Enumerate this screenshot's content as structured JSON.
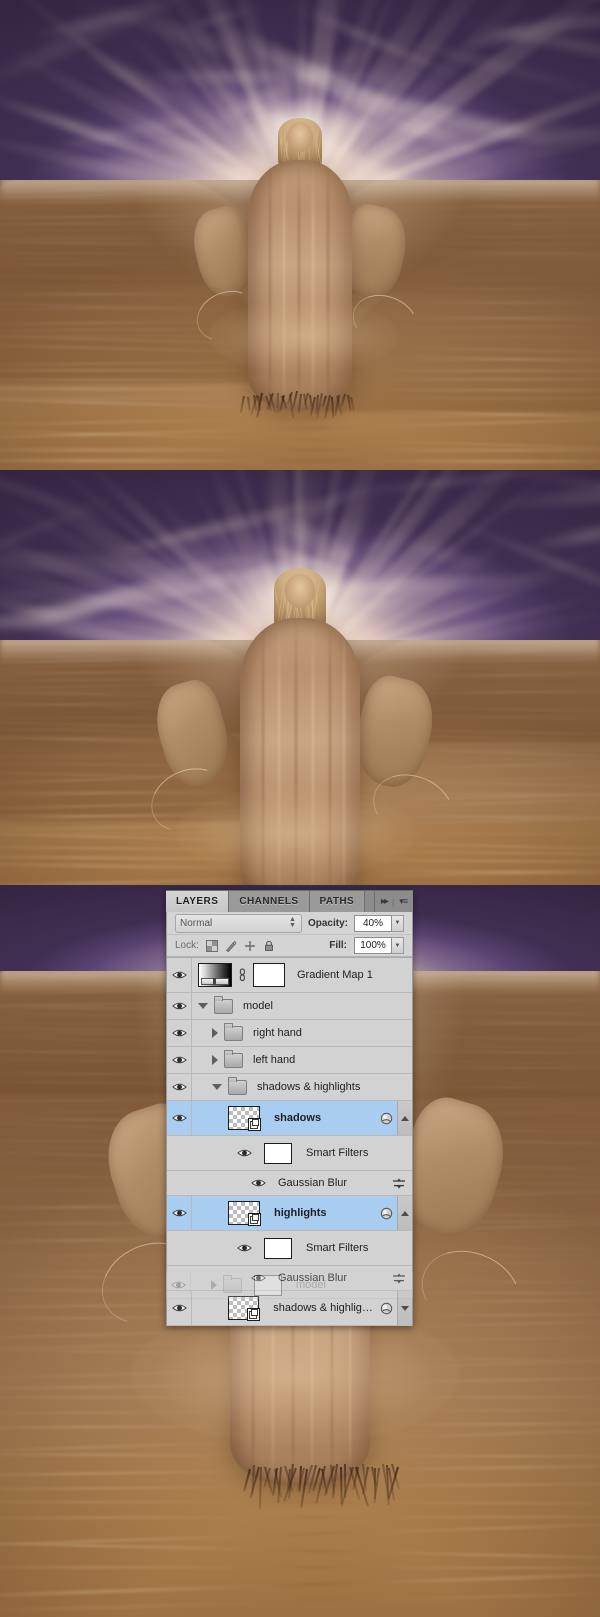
{
  "document": {
    "title": "Desert model photo manipulation — Photoshop layers panel",
    "panel_count": 3
  },
  "images": [
    {
      "name": "step-1-image",
      "caption": "Desert dunes under radiant sky with model figure, wide view"
    },
    {
      "name": "step-2-image",
      "caption": "Desert dunes under radiant sky with model figure, closer crop"
    },
    {
      "name": "step-3-image",
      "caption": "Desert dunes with model figure and Photoshop layers panel overlay"
    }
  ],
  "layers_panel": {
    "tabs": [
      {
        "label": "LAYERS",
        "active": true
      },
      {
        "label": "CHANNELS",
        "active": false
      },
      {
        "label": "PATHS",
        "active": false
      }
    ],
    "header_buttons": {
      "collapse": "▸▸",
      "separator": "|",
      "menu": "▾≡"
    },
    "blend": {
      "mode": "Normal",
      "opacity_label": "Opacity:",
      "opacity_value": "40%",
      "fill_label": "Fill:",
      "fill_value": "100%"
    },
    "lock": {
      "label": "Lock:",
      "icons": [
        "lock-transparent-pixels-icon",
        "lock-image-pixels-icon",
        "lock-position-icon",
        "lock-all-icon"
      ]
    },
    "rows": [
      {
        "name": "Gradient Map 1",
        "kind": "adjustment",
        "indent": 0,
        "visible": true,
        "selected": false,
        "bold": false,
        "thumb": "gradient-map-thumbnail",
        "mask": "layer-mask-white",
        "link": true,
        "disclosure": "none",
        "fx": false,
        "scroll": "none"
      },
      {
        "name": "model",
        "kind": "group",
        "indent": 0,
        "visible": true,
        "selected": false,
        "bold": false,
        "thumb": "folder-icon",
        "disclosure": "down",
        "fx": false,
        "scroll": "none"
      },
      {
        "name": "right hand",
        "kind": "group",
        "indent": 1,
        "visible": true,
        "selected": false,
        "bold": false,
        "thumb": "folder-icon",
        "disclosure": "right",
        "fx": false,
        "scroll": "none"
      },
      {
        "name": "left hand",
        "kind": "group",
        "indent": 1,
        "visible": true,
        "selected": false,
        "bold": false,
        "thumb": "folder-icon",
        "disclosure": "right",
        "fx": false,
        "scroll": "none"
      },
      {
        "name": "shadows & highlights",
        "kind": "group",
        "indent": 1,
        "visible": true,
        "selected": false,
        "bold": false,
        "thumb": "folder-icon",
        "disclosure": "down",
        "fx": false,
        "scroll": "none"
      },
      {
        "name": "shadows",
        "kind": "smart-object",
        "indent": 2,
        "visible": true,
        "selected": true,
        "bold": true,
        "thumb": "transparent-checker-thumbnail",
        "disclosure": "none",
        "fx": true,
        "scroll": "up"
      },
      {
        "name": "Smart Filters",
        "kind": "smart-filters",
        "indent": 3,
        "visible": true,
        "selected": false,
        "bold": false,
        "thumb": "filter-mask-white",
        "disclosure": "none",
        "fx": false,
        "scroll": "none"
      },
      {
        "name": "Gaussian Blur",
        "kind": "filter",
        "indent": 4,
        "visible": true,
        "selected": false,
        "bold": false,
        "thumb": "none",
        "disclosure": "none",
        "fx": false,
        "blend_options": "filter-blending-options-icon",
        "scroll": "none"
      },
      {
        "name": "highlights",
        "kind": "smart-object",
        "indent": 2,
        "visible": true,
        "selected": true,
        "bold": true,
        "thumb": "transparent-checker-thumbnail",
        "disclosure": "none",
        "fx": true,
        "scroll": "up"
      },
      {
        "name": "Smart Filters",
        "kind": "smart-filters",
        "indent": 3,
        "visible": true,
        "selected": false,
        "bold": false,
        "thumb": "filter-mask-white",
        "disclosure": "none",
        "fx": false,
        "scroll": "none"
      },
      {
        "name": "Gaussian Blur",
        "kind": "filter",
        "indent": 4,
        "visible": true,
        "selected": false,
        "bold": false,
        "thumb": "none",
        "disclosure": "none",
        "fx": false,
        "blend_options": "filter-blending-options-icon",
        "scroll": "none"
      },
      {
        "name": "shadows & highlights",
        "kind": "smart-object",
        "indent": 2,
        "visible": true,
        "selected": false,
        "bold": false,
        "thumb": "transparent-checker-thumbnail",
        "disclosure": "none",
        "fx": true,
        "scroll": "down"
      }
    ],
    "ghost_rows": [
      {
        "name": "model",
        "kind": "group",
        "indent": 1,
        "visible": true,
        "selected": false
      }
    ]
  },
  "colors": {
    "panel_bg": "#d4d4d4",
    "list_bg": "#d2d2d2",
    "selection": "#a9cdf0",
    "tabbar": "#8c8c8c",
    "active_tab": "#d6d6d6",
    "row_divider": "#b9b9b9",
    "text": "#1f1f1f",
    "muted_text": "#6a6a6a",
    "sand_light": "#c69a6b",
    "sand_dark": "#9b6f4e",
    "sky_violet": "#5b4573",
    "sky_glow": "#fffaf2"
  }
}
